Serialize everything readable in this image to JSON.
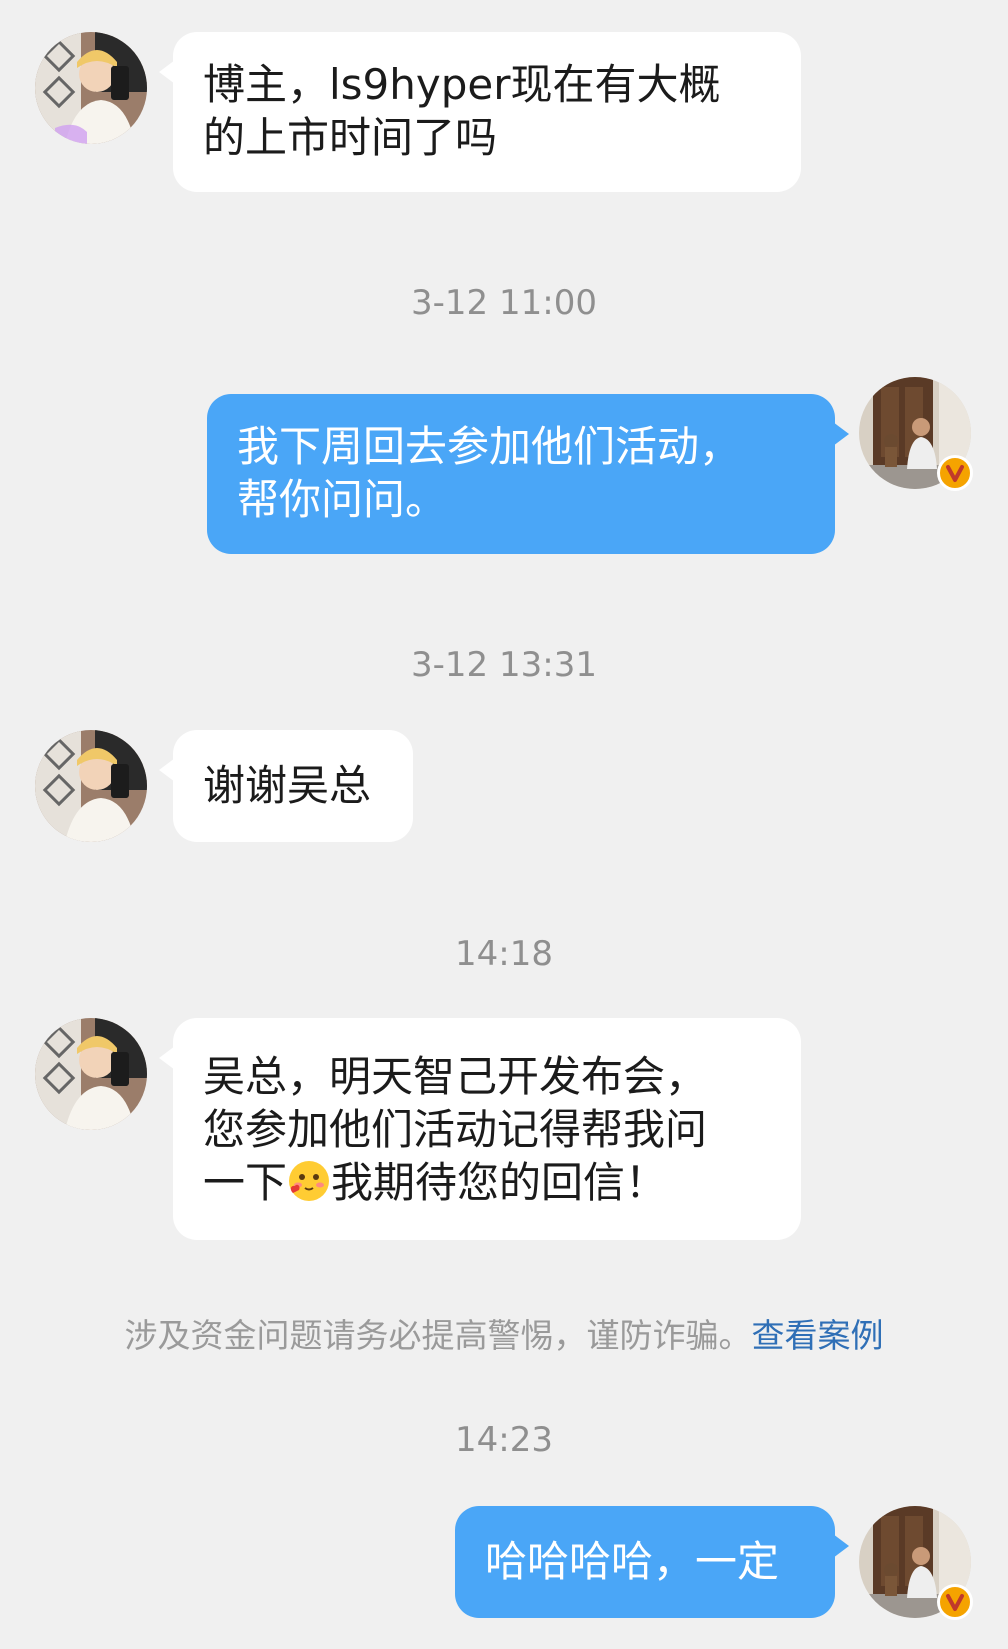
{
  "messages": [
    {
      "sender": "contact",
      "text": "博主，ls9hyper现在有大概\n的上市时间了吗"
    },
    {
      "type": "timestamp",
      "text": "3-12 11:00"
    },
    {
      "sender": "me",
      "text": "我下周回去参加他们活动，\n帮你问问。"
    },
    {
      "type": "timestamp",
      "text": "3-12 13:31"
    },
    {
      "sender": "contact",
      "text": "谢谢吴总"
    },
    {
      "type": "timestamp",
      "text": "14:18"
    },
    {
      "sender": "contact",
      "line1": "吴总，明天智己开发布会，",
      "line2": "您参加他们活动记得帮我问",
      "line3_before": "一下",
      "emoji": "blushing-face-with-heart",
      "line3_after": "我期待您的回信！"
    },
    {
      "type": "notice",
      "text": "涉及资金问题请务必提高警惕，谨防诈骗。",
      "link": "查看案例"
    },
    {
      "type": "timestamp",
      "text": "14:23"
    },
    {
      "sender": "me",
      "text": "哈哈哈哈，一定"
    }
  ],
  "avatars": {
    "contact": "contact-avatar",
    "me": "my-avatar",
    "verified_badge": "verified-v-badge-icon"
  },
  "colors": {
    "background": "#f0f0f0",
    "incoming_bubble": "#ffffff",
    "outgoing_bubble": "#4aa6f7",
    "timestamp": "#8f8f8f",
    "link": "#2f6fb6",
    "badge": "#f5a300"
  }
}
